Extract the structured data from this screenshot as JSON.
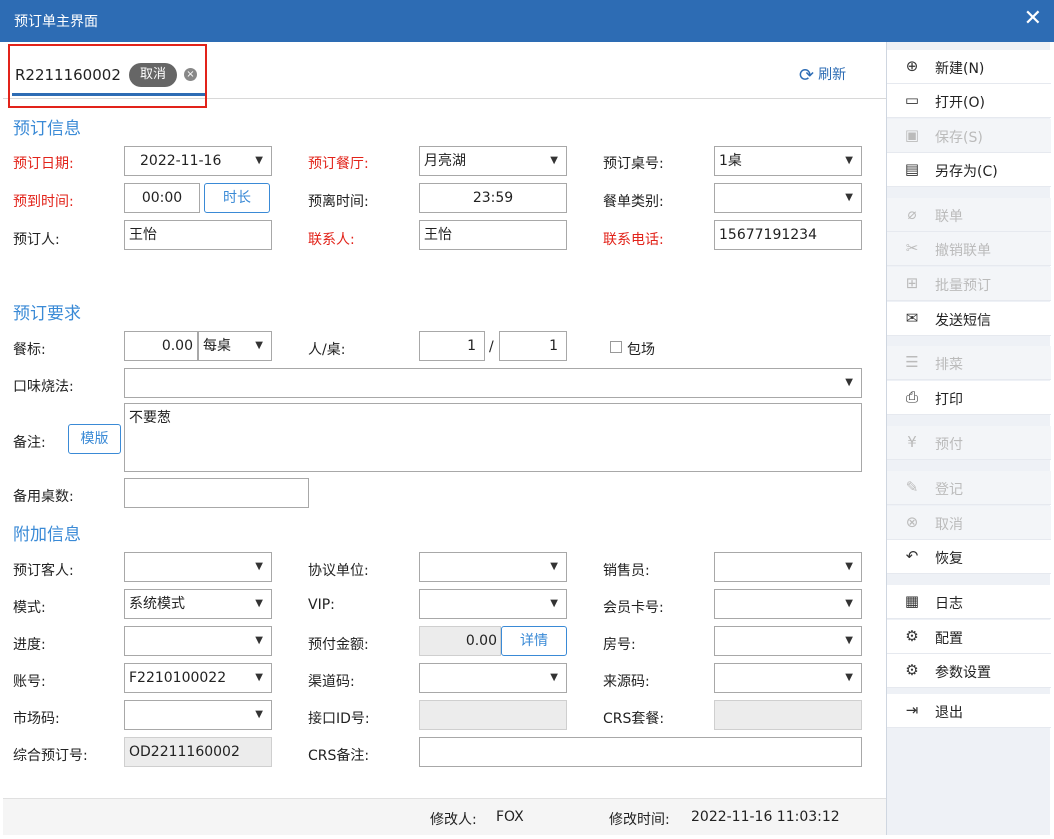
{
  "window": {
    "title": "预订单主界面",
    "close": "✕"
  },
  "tab": {
    "code": "R2211160002",
    "status_badge": "取消",
    "close": "×"
  },
  "refresh": {
    "icon": "⟳",
    "label": "刷新"
  },
  "sections": {
    "booking_info": "预订信息",
    "requirements": "预订要求",
    "extra": "附加信息"
  },
  "booking": {
    "date_label": "预订日期:",
    "date_value": "2022-11-16",
    "hall_label": "预订餐厅:",
    "hall_value": "月亮湖",
    "table_label": "预订桌号:",
    "table_value": "1桌",
    "arrive_label": "预到时间:",
    "arrive_value": "00:00",
    "duration_btn": "时长",
    "leave_label": "预离时间:",
    "leave_value": "23:59",
    "menu_type_label": "餐单类别:",
    "menu_type_value": "",
    "booker_label": "预订人:",
    "booker_value": "王怡",
    "contact_label": "联系人:",
    "contact_value": "王怡",
    "phone_label": "联系电话:",
    "phone_value": "15677191234"
  },
  "requirements": {
    "standard_label": "餐标:",
    "standard_value": "0.00",
    "standard_unit": "每桌",
    "per_table_label": "人/桌:",
    "persons": "1",
    "slash": "/",
    "tables": "1",
    "private_label": "包场",
    "taste_label": "口味烧法:",
    "taste_value": "",
    "remark_label": "备注:",
    "template_btn": "模版",
    "remark_value": "不要葱",
    "spare_label": "备用桌数:",
    "spare_value": ""
  },
  "extra": {
    "guest_label": "预订客人:",
    "guest_value": "",
    "agreement_label": "协议单位:",
    "agreement_value": "",
    "sales_label": "销售员:",
    "sales_value": "",
    "mode_label": "模式:",
    "mode_value": "系统模式",
    "vip_label": "VIP:",
    "vip_value": "",
    "member_label": "会员卡号:",
    "member_value": "",
    "progress_label": "进度:",
    "progress_value": "",
    "prepay_label": "预付金额:",
    "prepay_value": "0.00",
    "detail_btn": "详情",
    "room_label": "房号:",
    "room_value": "",
    "account_label": "账号:",
    "account_value": "F2210100022",
    "channel_label": "渠道码:",
    "channel_value": "",
    "source_label": "来源码:",
    "source_value": "",
    "market_label": "市场码:",
    "market_value": "",
    "interface_label": "接口ID号:",
    "interface_value": "",
    "crs_pkg_label": "CRS套餐:",
    "crs_pkg_value": "",
    "combined_label": "综合预订号:",
    "combined_value": "OD2211160002",
    "crs_remark_label": "CRS备注:",
    "crs_remark_value": ""
  },
  "status": {
    "modifier_label": "修改人:",
    "modifier": "FOX",
    "time_label": "修改时间:",
    "time": "2022-11-16 11:03:12"
  },
  "menu": [
    {
      "label": "新建(N)",
      "icon": "⊕"
    },
    {
      "label": "打开(O)",
      "icon": "▭"
    },
    {
      "label": "保存(S)",
      "icon": "▣"
    },
    {
      "label": "另存为(C)",
      "icon": "▤"
    },
    {
      "label": "联单",
      "icon": "⌀"
    },
    {
      "label": "撤销联单",
      "icon": "✂"
    },
    {
      "label": "批量预订",
      "icon": "⊞"
    },
    {
      "label": "发送短信",
      "icon": "✉"
    },
    {
      "label": "排菜",
      "icon": "☰"
    },
    {
      "label": "打印",
      "icon": "⎙"
    },
    {
      "label": "预付",
      "icon": "¥"
    },
    {
      "label": "登记",
      "icon": "✎"
    },
    {
      "label": "取消",
      "icon": "⊗"
    },
    {
      "label": "恢复",
      "icon": "↶"
    },
    {
      "label": "日志",
      "icon": "▦"
    },
    {
      "label": "配置",
      "icon": "⚙"
    },
    {
      "label": "参数设置",
      "icon": "⚙"
    },
    {
      "label": "退出",
      "icon": "⇥"
    }
  ],
  "dropdown_arrow": "▼"
}
